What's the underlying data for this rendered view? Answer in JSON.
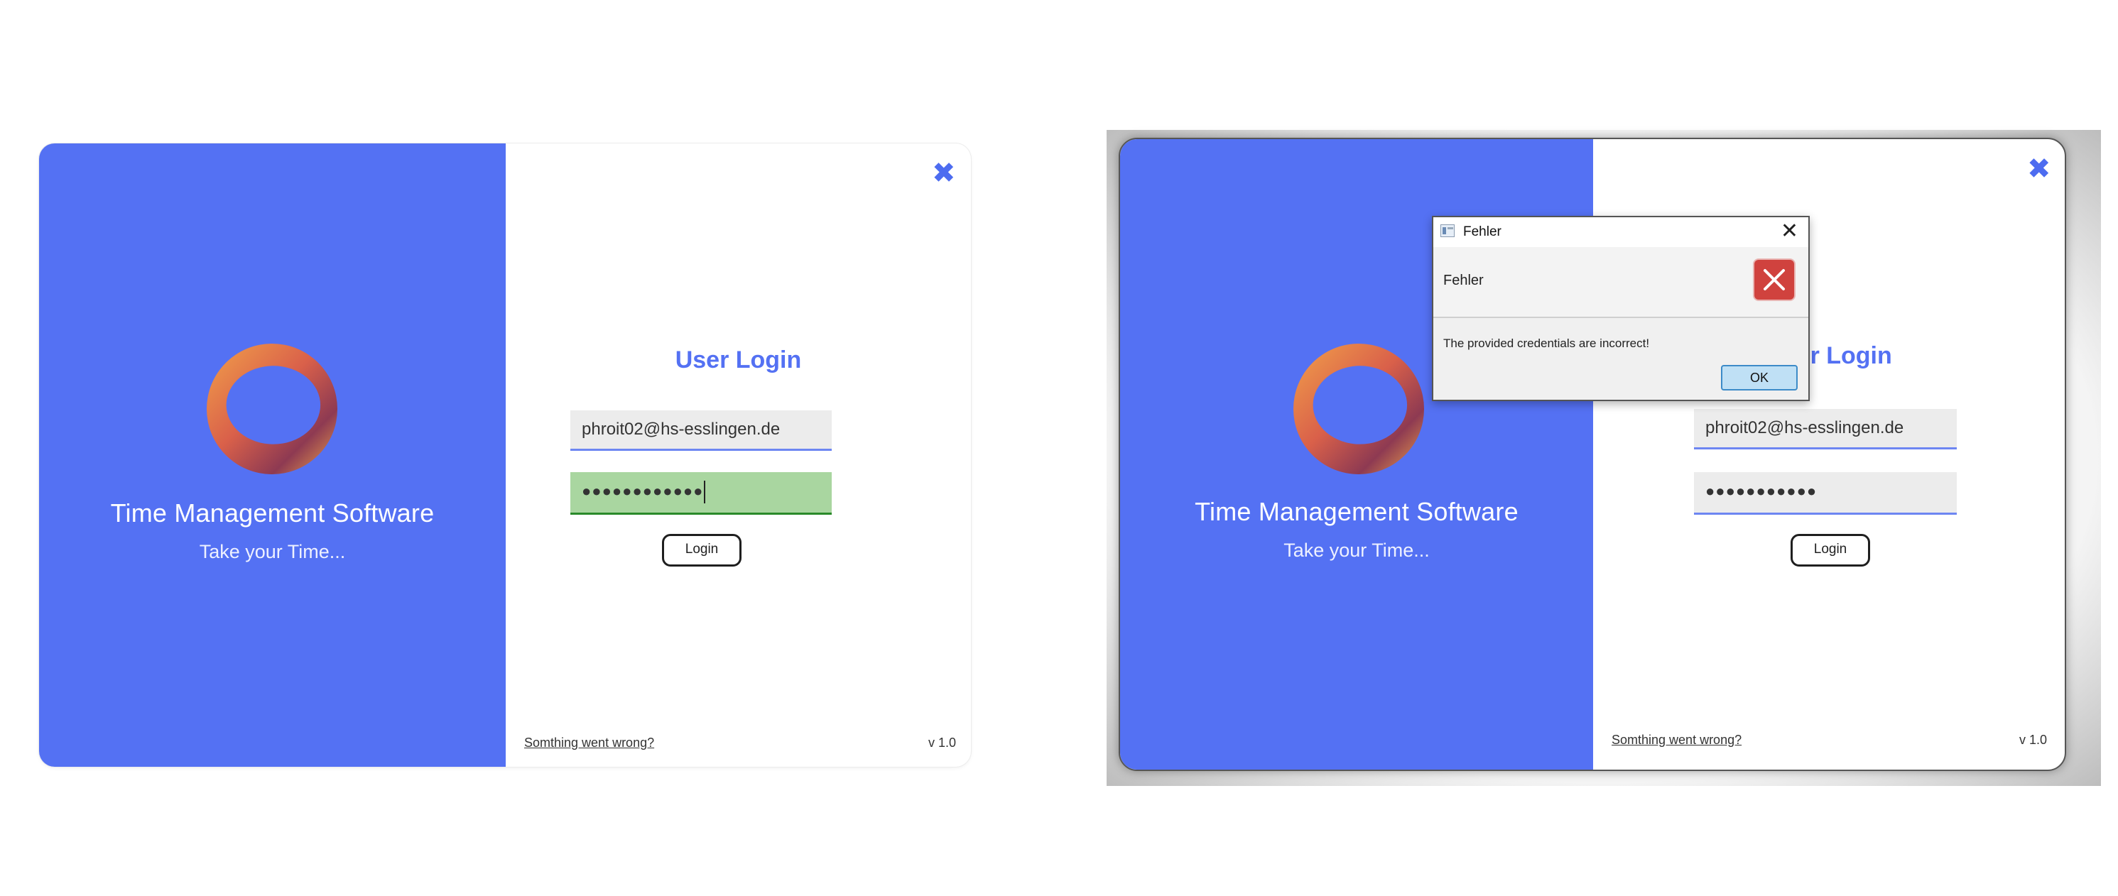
{
  "brand": {
    "accent": "#5471f3",
    "error": "#d0423e",
    "valid_field": "#a9d6a0"
  },
  "screens": [
    {
      "app_name": "Time Management Software",
      "tagline": "Take your Time...",
      "login_title": "User Login",
      "email_value": "phroit02@hs-esslingen.de",
      "password_value": "●●●●●●●●●●●●",
      "password_state": "valid",
      "login_button": "Login",
      "help_link": "Somthing went wrong?",
      "version": "v 1.0",
      "close_icon": "close-icon"
    },
    {
      "app_name": "Time Management Software",
      "tagline": "Take your Time...",
      "login_title": "User Login",
      "email_value": "phroit02@hs-esslingen.de",
      "password_value": "●●●●●●●●●●●",
      "login_button": "Login",
      "help_link": "Somthing went wrong?",
      "version": "v 1.0",
      "close_icon": "close-icon"
    }
  ],
  "dialog": {
    "title": "Fehler",
    "header": "Fehler",
    "message": "The provided credentials are incorrect!",
    "ok_button": "OK",
    "icon": "error-icon"
  }
}
